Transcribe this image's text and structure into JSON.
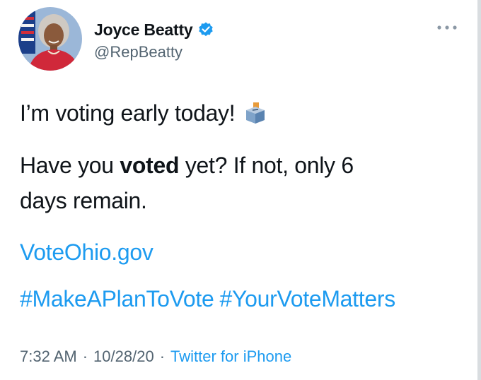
{
  "author": {
    "display_name": "Joyce Beatty",
    "handle": "@RepBeatty",
    "verified": true,
    "avatar_icon": "profile-photo"
  },
  "tweet": {
    "line1": "I’m voting early today!",
    "line1_emoji": "ballot-box-icon",
    "line2_before": "Have you ",
    "line2_bold": "voted",
    "line2_after": " yet? If not, only 6",
    "line3": "days remain.",
    "link": "VoteOhio.gov",
    "hashtags": [
      "#MakeAPlanToVote",
      "#YourVoteMatters"
    ]
  },
  "meta": {
    "time": "7:32 AM",
    "separator": "·",
    "date": "10/28/20",
    "source": "Twitter for iPhone"
  },
  "colors": {
    "link": "#1d9bf0",
    "secondary_text": "#536471",
    "primary_text": "#0f1419",
    "verified": "#1d9bf0"
  }
}
